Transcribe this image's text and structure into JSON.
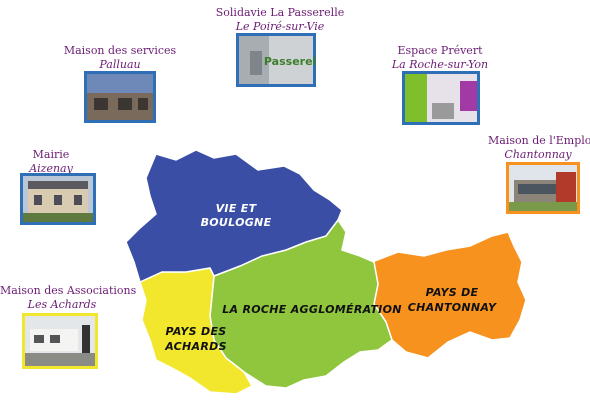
{
  "sites": [
    {
      "id": "passerelle",
      "name": "Solidavie La Passerelle",
      "town": "Le Poiré-sur-Vie",
      "photo_text": "Passerell"
    },
    {
      "id": "palluau",
      "name": "Maison des services",
      "town": "Palluau"
    },
    {
      "id": "prevert",
      "name": "Espace Prévert",
      "town": "La Roche-sur-Yon"
    },
    {
      "id": "aizenay",
      "name": "Mairie",
      "town": "Aizenay"
    },
    {
      "id": "chantonnay",
      "name": "Maison de l'Emploi",
      "town": "Chantonnay"
    },
    {
      "id": "achards",
      "name": "Maison des Associations",
      "town": "Les Achards"
    }
  ],
  "regions": {
    "vie_boulogne": {
      "line1": "VIE ET",
      "line2": "BOULOGNE",
      "color": "#3a4ea5"
    },
    "roche": {
      "line1": "LA ROCHE AGGLOMÉRATION",
      "color": "#8fc63e"
    },
    "chantonnay": {
      "line1": "PAYS DE",
      "line2": "CHANTONNAY",
      "color": "#f7921e"
    },
    "achards": {
      "line1": "PAYS DES",
      "line2": "ACHARDS",
      "color": "#f2e72c"
    }
  },
  "colors": {
    "site_text": "#6b1d74",
    "photo_border": "#2e6fb5"
  }
}
